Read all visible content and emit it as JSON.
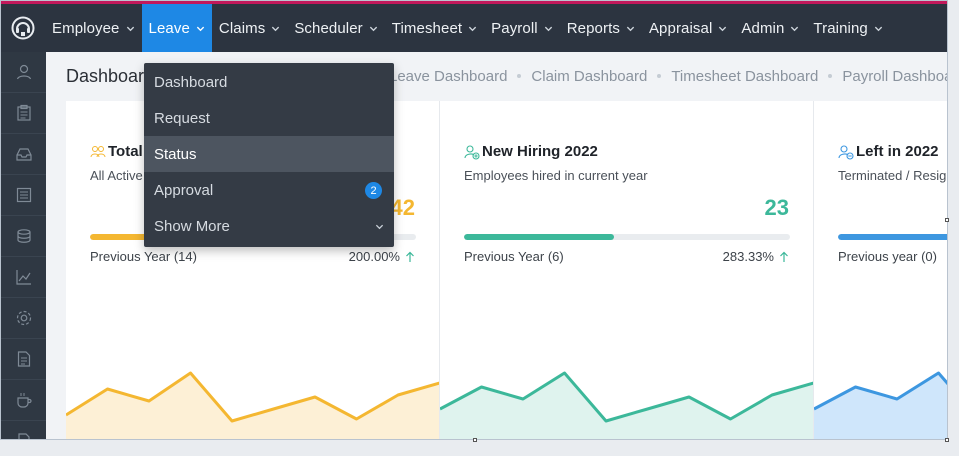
{
  "nav": {
    "items": [
      {
        "label": "Employee",
        "active": false
      },
      {
        "label": "Leave",
        "active": true
      },
      {
        "label": "Claims",
        "active": false
      },
      {
        "label": "Scheduler",
        "active": false
      },
      {
        "label": "Timesheet",
        "active": false
      },
      {
        "label": "Payroll",
        "active": false
      },
      {
        "label": "Reports",
        "active": false
      },
      {
        "label": "Appraisal",
        "active": false
      },
      {
        "label": "Admin",
        "active": false
      },
      {
        "label": "Training",
        "active": false
      }
    ]
  },
  "page": {
    "title": "Dashboard",
    "breadcrumbs": [
      "Leave Dashboard",
      "Claim Dashboard",
      "Timesheet Dashboard",
      "Payroll Dashboard"
    ]
  },
  "dropdown": {
    "items": [
      "Dashboard",
      "Request",
      "Status",
      "Approval",
      "Show More"
    ],
    "approval_badge": "2",
    "hovered": "Status"
  },
  "cards": [
    {
      "title": "Total Employees",
      "subtitle": "All Active Employees",
      "value": "42",
      "color": "#f4b731",
      "area_color": "#fdf0d6",
      "progress": 0.46,
      "prev": "Previous Year (14)",
      "pct": "200.00%",
      "icon": "users-icon",
      "spark": [
        16,
        42,
        30,
        58,
        10,
        22,
        34,
        12,
        36,
        48
      ]
    },
    {
      "title": "New Hiring 2022",
      "subtitle": "Employees hired in current year",
      "value": "23",
      "color": "#3cb89a",
      "area_color": "#dff3ee",
      "progress": 0.46,
      "prev": "Previous Year (6)",
      "pct": "283.33%",
      "icon": "user-add-icon",
      "spark": [
        22,
        44,
        32,
        58,
        10,
        22,
        34,
        12,
        36,
        48
      ]
    },
    {
      "title": "Left in 2022",
      "subtitle": "Terminated / Resigned",
      "value": "",
      "color": "#3d97e0",
      "area_color": "#cfe6fb",
      "progress": 0.4,
      "prev": "Previous year (0)",
      "pct": "",
      "icon": "user-remove-icon",
      "spark": [
        22,
        44,
        32,
        58,
        10
      ]
    }
  ],
  "sidebar": {
    "icons": [
      "user-icon",
      "clipboard-icon",
      "inbox-icon",
      "list-icon",
      "stack-icon",
      "chart-icon",
      "settings-icon",
      "document-icon",
      "coffee-icon",
      "file-icon"
    ]
  }
}
